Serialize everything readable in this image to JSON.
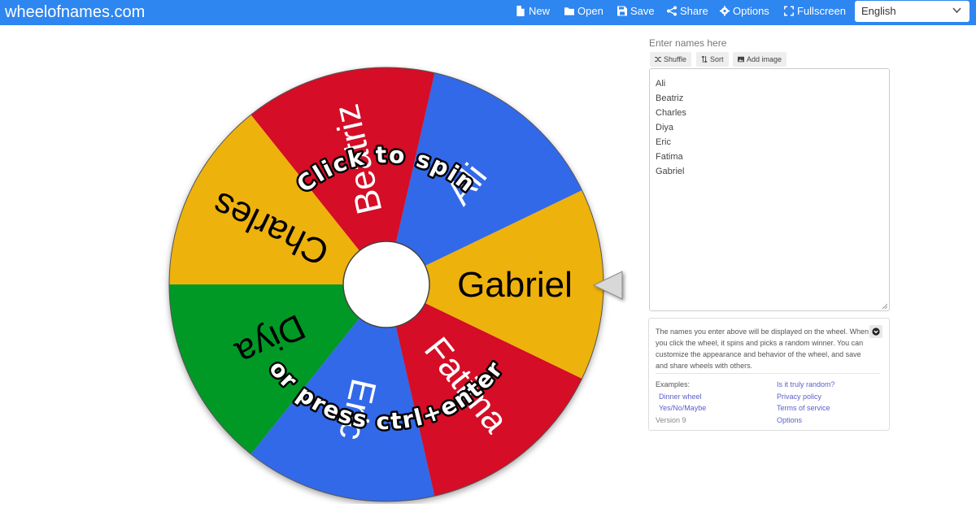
{
  "brand": "wheelofnames.com",
  "nav": {
    "new": "New",
    "open": "Open",
    "save": "Save",
    "share": "Share",
    "options": "Options",
    "fullscreen": "Fullscreen"
  },
  "language": {
    "selected": "English"
  },
  "wheel": {
    "prompt_line1": "Click to spin",
    "prompt_line2": "or press ctrl+enter",
    "segments": [
      {
        "name": "Ali",
        "color": "#3369e8"
      },
      {
        "name": "Beatriz",
        "color": "#d50f25"
      },
      {
        "name": "Charles",
        "color": "#eeb211"
      },
      {
        "name": "Diya",
        "color": "#009925"
      },
      {
        "name": "Eric",
        "color": "#3369e8"
      },
      {
        "name": "Fatima",
        "color": "#d50f25"
      },
      {
        "name": "Gabriel",
        "color": "#eeb211"
      }
    ]
  },
  "sidebar": {
    "label": "Enter names here",
    "shuffle": "Shuffle",
    "sort": "Sort",
    "add_image": "Add image",
    "names": [
      "Ali",
      "Beatriz",
      "Charles",
      "Diya",
      "Eric",
      "Fatima",
      "Gabriel"
    ],
    "info": "The names you enter above will be displayed on the wheel. When you click the wheel, it spins and picks a random winner. You can customize the appearance and behavior of the wheel, and save and share wheels with others.",
    "examples_label": "Examples:",
    "example_links": [
      "Dinner wheel",
      "Yes/No/Maybe"
    ],
    "version": "Version 9",
    "right_links": [
      "Is it truly random?",
      "Privacy policy",
      "Terms of service",
      "Options"
    ]
  }
}
